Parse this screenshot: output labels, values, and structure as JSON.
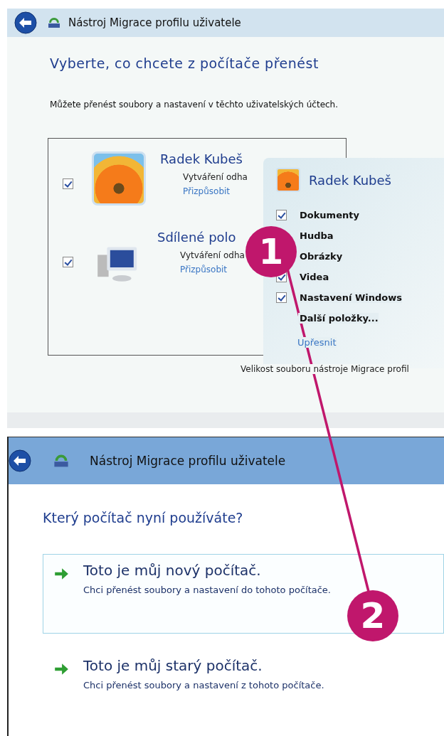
{
  "top_window": {
    "title": "Nástroj Migrace profilu uživatele",
    "heading": "Vyberte, co chcete z počítače přenést",
    "description": "Můžete přenést soubory a nastavení v těchto uživatelských účtech.",
    "accounts": [
      {
        "kind": "user",
        "checked": true,
        "name": "Radek Kubeš",
        "status": "Vytváření odha",
        "link": "Přizpůsobit"
      },
      {
        "kind": "shared",
        "checked": true,
        "name": "Sdílené polo",
        "status": "Vytváření odha",
        "link": "Přizpůsobit"
      }
    ],
    "popup": {
      "name": "Radek Kubeš",
      "items": [
        {
          "kind": "checkbox",
          "label": "Dokumenty",
          "checked": true
        },
        {
          "kind": "covered",
          "label": "Hudba"
        },
        {
          "kind": "covered",
          "label": "Obrázky"
        },
        {
          "kind": "checkbox",
          "label": "Videa",
          "checked": true
        },
        {
          "kind": "checkbox",
          "label": "Nastavení Windows",
          "checked": true
        },
        {
          "kind": "more",
          "label": "Další položky..."
        }
      ],
      "link": "Upřesnit"
    },
    "footer": "Velikost souboru nástroje Migrace profil"
  },
  "bottom_window": {
    "title": "Nástroj Migrace profilu uživatele",
    "heading": "Který počítač nyní používáte?",
    "options": [
      {
        "title": "Toto je můj nový počítač.",
        "description": "Chci přenést soubory a nastavení do tohoto počítače.",
        "selected": true
      },
      {
        "title": "Toto je můj starý počítač.",
        "description": "Chci přenést soubory a nastavení z tohoto počítače.",
        "selected": false
      }
    ]
  },
  "callouts": [
    "1",
    "2"
  ]
}
